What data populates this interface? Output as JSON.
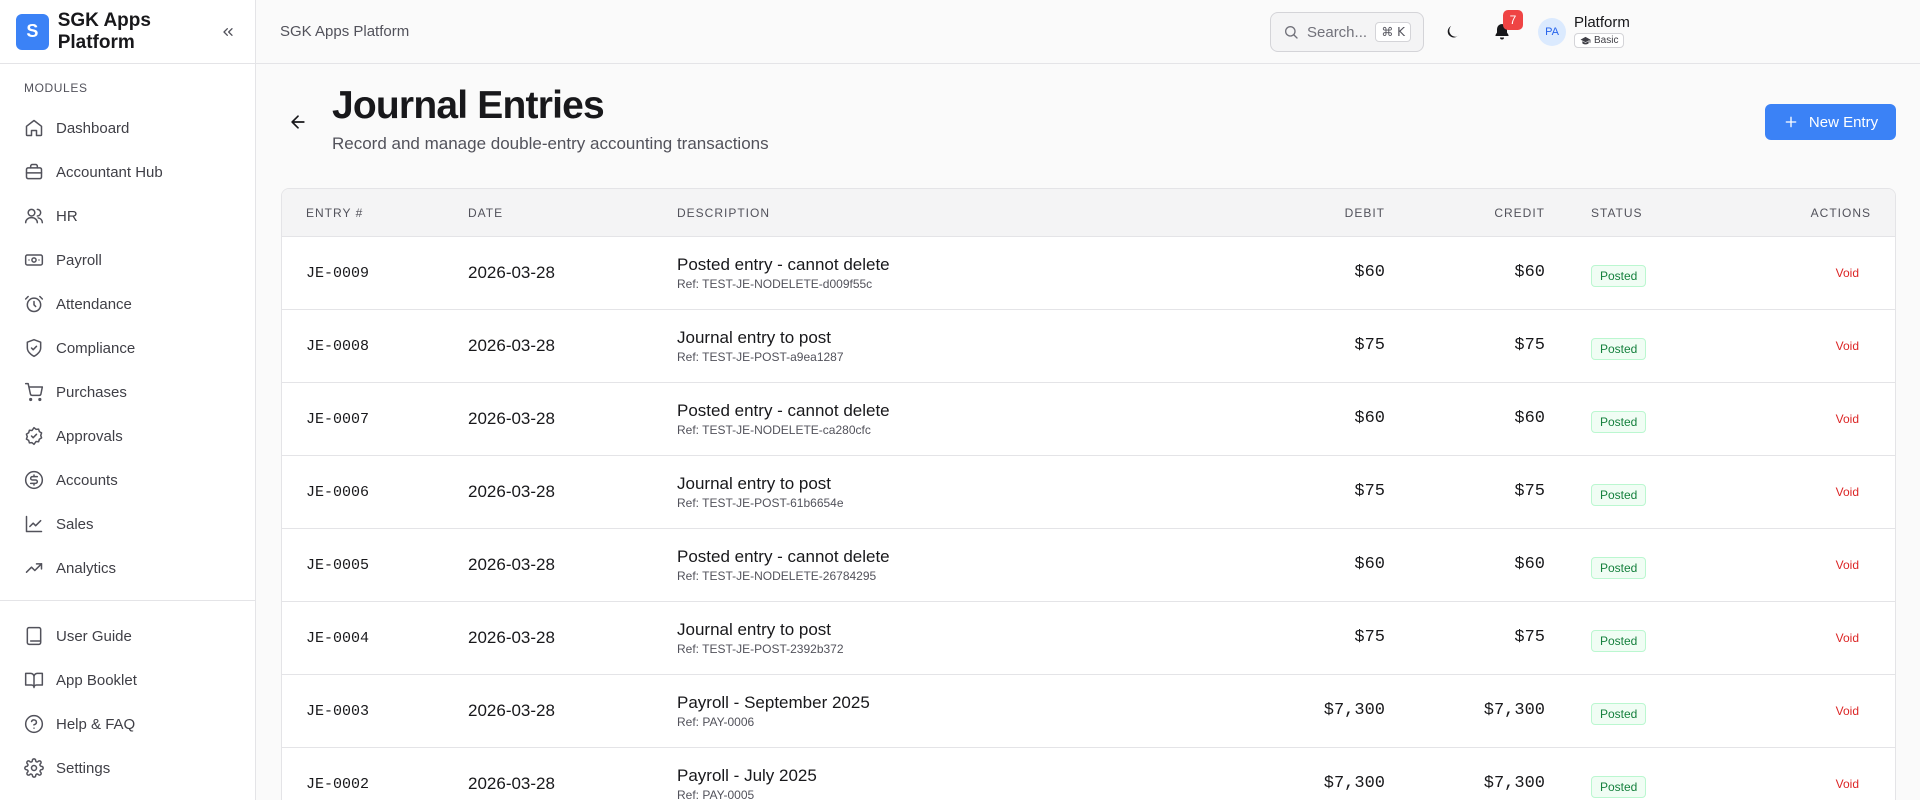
{
  "app": {
    "logo_letter": "S",
    "name": "SGK Apps Platform"
  },
  "sidebar": {
    "section_label": "MODULES",
    "items": [
      {
        "label": "Dashboard",
        "icon": "home-icon"
      },
      {
        "label": "Accountant Hub",
        "icon": "briefcase-icon"
      },
      {
        "label": "HR",
        "icon": "users-icon"
      },
      {
        "label": "Payroll",
        "icon": "banknote-icon"
      },
      {
        "label": "Attendance",
        "icon": "clock-icon"
      },
      {
        "label": "Compliance",
        "icon": "shield-icon"
      },
      {
        "label": "Purchases",
        "icon": "cart-icon"
      },
      {
        "label": "Approvals",
        "icon": "badge-check-icon"
      },
      {
        "label": "Accounts",
        "icon": "dollar-icon"
      },
      {
        "label": "Sales",
        "icon": "trending-up-icon"
      },
      {
        "label": "Analytics",
        "icon": "line-chart-icon"
      }
    ],
    "bottom_items": [
      {
        "label": "User Guide",
        "icon": "book-icon"
      },
      {
        "label": "App Booklet",
        "icon": "book-open-icon"
      },
      {
        "label": "Help & FAQ",
        "icon": "help-circle-icon"
      },
      {
        "label": "Settings",
        "icon": "gear-icon"
      }
    ]
  },
  "topbar": {
    "breadcrumb": "SGK Apps Platform",
    "search_placeholder": "Search...",
    "search_shortcut": "⌘ K",
    "notification_count": "7",
    "avatar_initials": "PA",
    "org_name": "Platform",
    "plan": "Basic"
  },
  "page": {
    "title": "Journal Entries",
    "subtitle": "Record and manage double-entry accounting transactions",
    "new_button": "New Entry"
  },
  "table": {
    "columns": [
      "ENTRY #",
      "DATE",
      "DESCRIPTION",
      "DEBIT",
      "CREDIT",
      "STATUS",
      "ACTIONS"
    ],
    "rows": [
      {
        "entry": "JE-0009",
        "date": "2026-03-28",
        "description": "Posted entry - cannot delete",
        "ref": "Ref: TEST-JE-NODELETE-d009f55c",
        "debit": "$60",
        "credit": "$60",
        "status": "Posted",
        "action": "Void"
      },
      {
        "entry": "JE-0008",
        "date": "2026-03-28",
        "description": "Journal entry to post",
        "ref": "Ref: TEST-JE-POST-a9ea1287",
        "debit": "$75",
        "credit": "$75",
        "status": "Posted",
        "action": "Void"
      },
      {
        "entry": "JE-0007",
        "date": "2026-03-28",
        "description": "Posted entry - cannot delete",
        "ref": "Ref: TEST-JE-NODELETE-ca280cfc",
        "debit": "$60",
        "credit": "$60",
        "status": "Posted",
        "action": "Void"
      },
      {
        "entry": "JE-0006",
        "date": "2026-03-28",
        "description": "Journal entry to post",
        "ref": "Ref: TEST-JE-POST-61b6654e",
        "debit": "$75",
        "credit": "$75",
        "status": "Posted",
        "action": "Void"
      },
      {
        "entry": "JE-0005",
        "date": "2026-03-28",
        "description": "Posted entry - cannot delete",
        "ref": "Ref: TEST-JE-NODELETE-26784295",
        "debit": "$60",
        "credit": "$60",
        "status": "Posted",
        "action": "Void"
      },
      {
        "entry": "JE-0004",
        "date": "2026-03-28",
        "description": "Journal entry to post",
        "ref": "Ref: TEST-JE-POST-2392b372",
        "debit": "$75",
        "credit": "$75",
        "status": "Posted",
        "action": "Void"
      },
      {
        "entry": "JE-0003",
        "date": "2026-03-28",
        "description": "Payroll - September 2025",
        "ref": "Ref: PAY-0006",
        "debit": "$7,300",
        "credit": "$7,300",
        "status": "Posted",
        "action": "Void"
      },
      {
        "entry": "JE-0002",
        "date": "2026-03-28",
        "description": "Payroll - July 2025",
        "ref": "Ref: PAY-0005",
        "debit": "$7,300",
        "credit": "$7,300",
        "status": "Posted",
        "action": "Void"
      }
    ]
  },
  "colors": {
    "accent": "#3b82f6",
    "danger": "#dc2626",
    "success": "#15803d",
    "badge": "#ef4444"
  }
}
